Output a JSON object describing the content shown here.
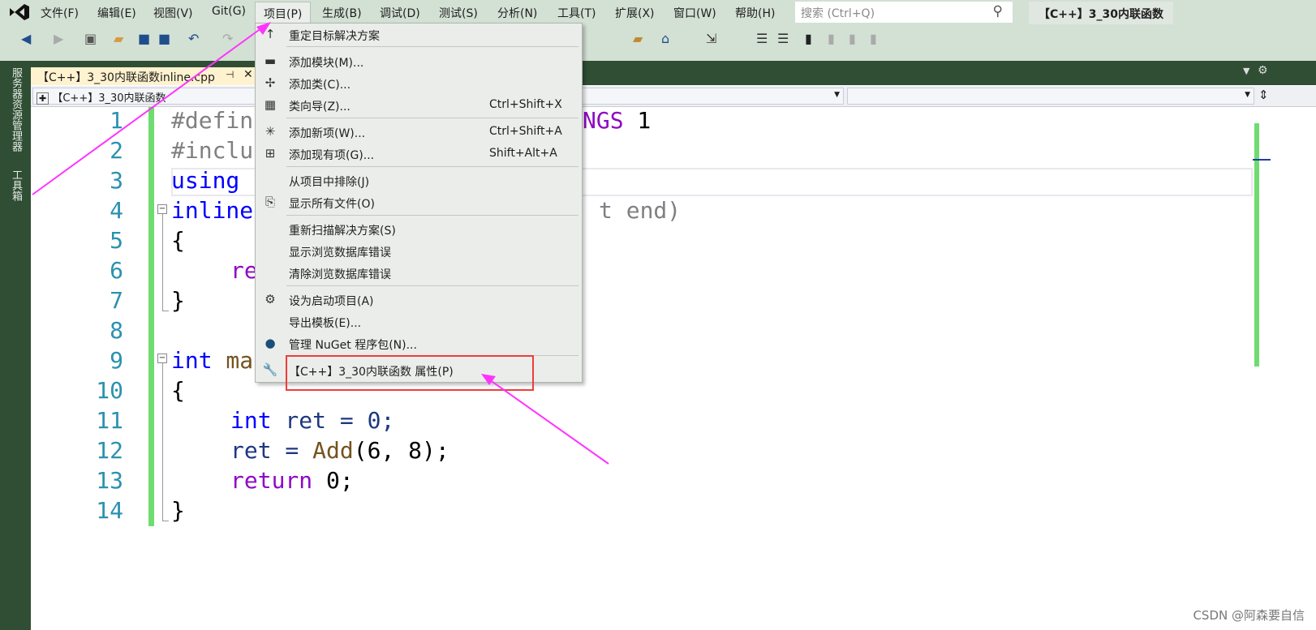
{
  "menubar": {
    "items": [
      "文件(F)",
      "编辑(E)",
      "视图(V)",
      "Git(G)",
      "项目(P)",
      "生成(B)",
      "调试(D)",
      "测试(S)",
      "分析(N)",
      "工具(T)",
      "扩展(X)",
      "窗口(W)",
      "帮助(H)"
    ],
    "active": "项目(P)"
  },
  "search": {
    "placeholder": "搜索 (Ctrl+Q)"
  },
  "window_title": "【C++】3_30内联函数",
  "sidebar": {
    "server_explorer": "服务器资源管理器",
    "toolbox": "工具箱"
  },
  "tab": {
    "label": "【C++】3_30内联函数inline.cpp"
  },
  "nav": {
    "project": "【C++】3_30内联函数"
  },
  "editor": {
    "line_numbers": [
      "1",
      "2",
      "3",
      "4",
      "5",
      "6",
      "7",
      "8",
      "9",
      "10",
      "11",
      "12",
      "13",
      "14"
    ]
  },
  "code": {
    "l1a": "#defin",
    "l1b": "NGS",
    "l1c": " 1",
    "l2a": "#inclu",
    "l3a": "using",
    "l4a": "inline",
    "l4b": "t end)",
    "l5": "{",
    "l6a": "re",
    "l7": "}",
    "l9a": "int",
    "l9b": " ma",
    "l10": "{",
    "l11a": "int",
    "l11b": " ret = 0;",
    "l12a": "ret = ",
    "l12b": "Add",
    "l12c": "(6, 8);",
    "l13a": "return",
    "l13b": " 0;",
    "l14": "}"
  },
  "menu": {
    "items": [
      {
        "label": "重定目标解决方案",
        "icon": "arrow-up-icon",
        "shortcut": ""
      },
      {
        "label": "添加模块(M)...",
        "icon": "add-module-icon",
        "shortcut": ""
      },
      {
        "label": "添加类(C)...",
        "icon": "add-class-icon",
        "shortcut": ""
      },
      {
        "label": "类向导(Z)...",
        "icon": "class-wizard-icon",
        "shortcut": "Ctrl+Shift+X"
      },
      {
        "label": "添加新项(W)...",
        "icon": "add-new-item-icon",
        "shortcut": "Ctrl+Shift+A"
      },
      {
        "label": "添加现有项(G)...",
        "icon": "add-existing-item-icon",
        "shortcut": "Shift+Alt+A"
      },
      {
        "label": "从项目中排除(J)",
        "icon": "",
        "shortcut": ""
      },
      {
        "label": "显示所有文件(O)",
        "icon": "show-all-files-icon",
        "shortcut": ""
      },
      {
        "label": "重新扫描解决方案(S)",
        "icon": "",
        "shortcut": ""
      },
      {
        "label": "显示浏览数据库错误",
        "icon": "",
        "shortcut": ""
      },
      {
        "label": "清除浏览数据库错误",
        "icon": "",
        "shortcut": ""
      },
      {
        "label": "设为启动项目(A)",
        "icon": "gear-icon",
        "shortcut": ""
      },
      {
        "label": "导出模板(E)...",
        "icon": "",
        "shortcut": ""
      },
      {
        "label": "管理 NuGet 程序包(N)...",
        "icon": "nuget-icon",
        "shortcut": ""
      },
      {
        "label": "【C++】3_30内联函数 属性(P)",
        "icon": "wrench-icon",
        "shortcut": ""
      }
    ]
  },
  "annotation_color": "#ff33ff",
  "highlight_color": "#f03c3c",
  "watermark": "CSDN @阿森要自信"
}
